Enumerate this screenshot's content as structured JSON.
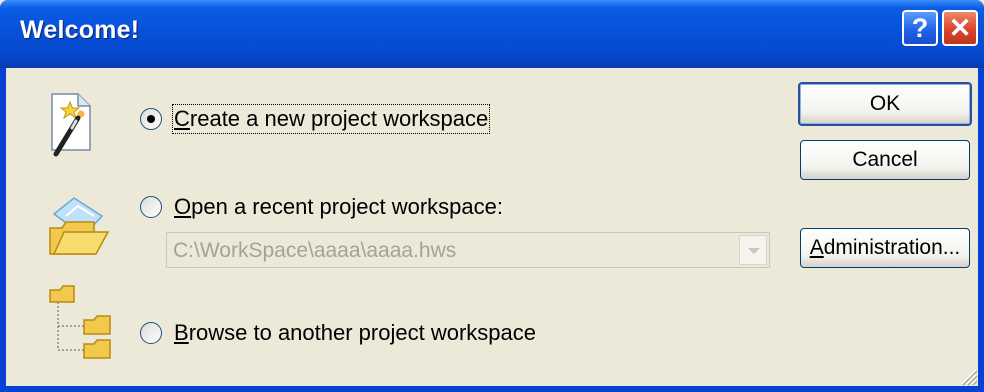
{
  "window": {
    "title": "Welcome!",
    "help_glyph": "?",
    "close_glyph": "✕"
  },
  "options": [
    {
      "label": "Create a new project workspace",
      "mnemonic": "C",
      "checked": true,
      "icon": "new-project-wizard-icon"
    },
    {
      "label": "Open a recent project workspace:",
      "mnemonic": "O",
      "checked": false,
      "icon": "open-folder-icon"
    },
    {
      "label": "Browse to another project workspace",
      "mnemonic": "B",
      "checked": false,
      "icon": "folder-tree-icon"
    }
  ],
  "recent_combo": {
    "value": "C:\\WorkSpace\\aaaa\\aaaa.hws",
    "disabled": true
  },
  "buttons": {
    "ok": "OK",
    "cancel": "Cancel",
    "administration": "Administration..."
  },
  "colors": {
    "titlebar": "#0850d8",
    "face": "#ECE9D8",
    "close": "#d8452a",
    "help": "#1f5fe6"
  }
}
